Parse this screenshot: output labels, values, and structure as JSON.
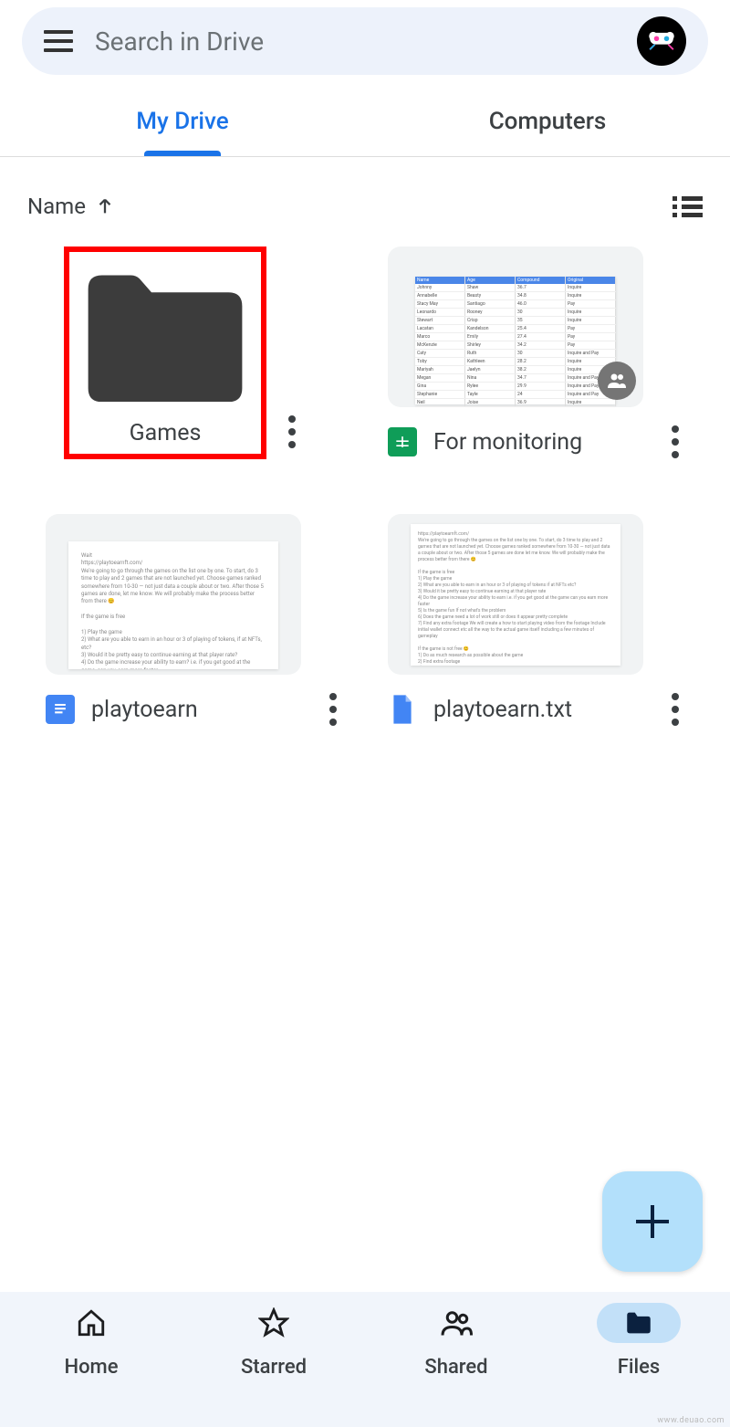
{
  "search": {
    "placeholder": "Search in Drive"
  },
  "tabs": {
    "mydrive": "My Drive",
    "computers": "Computers"
  },
  "sort": {
    "label": "Name"
  },
  "items": [
    {
      "name": "Games",
      "type": "folder"
    },
    {
      "name": "For monitoring",
      "type": "sheets",
      "shared": true
    },
    {
      "name": "playtoearn",
      "type": "docs"
    },
    {
      "name": "playtoearn.txt",
      "type": "file"
    }
  ],
  "nav": {
    "home": "Home",
    "starred": "Starred",
    "shared": "Shared",
    "files": "Files"
  },
  "watermark": "www.deuao.com"
}
